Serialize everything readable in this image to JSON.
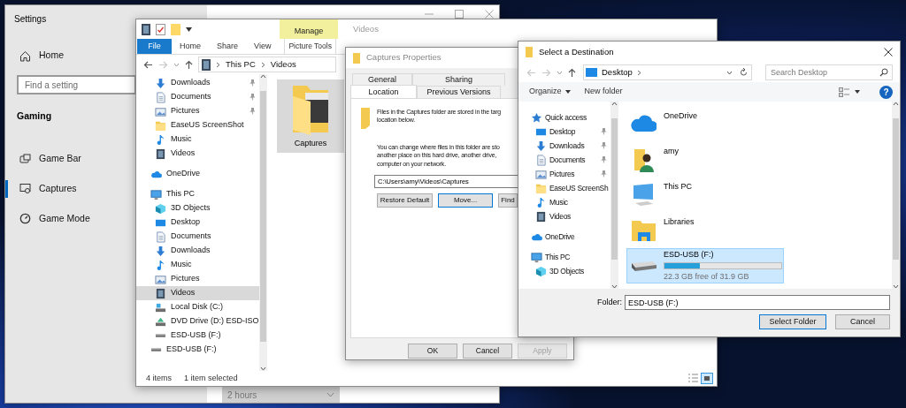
{
  "settings": {
    "title": "Settings",
    "home": {
      "label": "Home"
    },
    "search": {
      "placeholder": "Find a setting"
    },
    "section": "Gaming",
    "items": [
      {
        "kind": "game_bar",
        "label": "Game Bar",
        "selected": false
      },
      {
        "kind": "captures",
        "label": "Captures",
        "selected": true
      },
      {
        "kind": "game_mode",
        "label": "Game Mode",
        "selected": false
      }
    ],
    "duration": {
      "value": "2 hours"
    }
  },
  "explorer": {
    "title": "Videos",
    "ribbon_tabs": [
      {
        "kind": "file",
        "label": "File"
      },
      {
        "kind": "tab",
        "label": "Home"
      },
      {
        "kind": "tab",
        "label": "Share"
      },
      {
        "kind": "tab",
        "label": "View"
      }
    ],
    "context_tab": {
      "group": "Manage",
      "label": "Picture Tools"
    },
    "breadcrumb": [
      "This PC",
      "Videos"
    ],
    "quick_access": [
      {
        "kind": "download",
        "label": "Downloads",
        "pinned": true,
        "selected": false
      },
      {
        "kind": "document",
        "label": "Documents",
        "pinned": true,
        "selected": false
      },
      {
        "kind": "picture",
        "label": "Pictures",
        "pinned": true,
        "selected": false
      },
      {
        "kind": "folder",
        "label": "EaseUS ScreenShot",
        "pinned": false,
        "selected": false
      },
      {
        "kind": "music",
        "label": "Music",
        "pinned": false,
        "selected": false
      },
      {
        "kind": "video",
        "label": "Videos",
        "pinned": false,
        "selected": false
      }
    ],
    "tree": [
      {
        "kind": "cloud",
        "label": "OneDrive",
        "selected": false
      },
      {
        "kind": "pc",
        "label": "This PC",
        "selected": false,
        "children": [
          {
            "kind": "cube",
            "label": "3D Objects",
            "selected": false
          },
          {
            "kind": "desktop",
            "label": "Desktop",
            "selected": false
          },
          {
            "kind": "document",
            "label": "Documents",
            "selected": false
          },
          {
            "kind": "download",
            "label": "Downloads",
            "selected": false
          },
          {
            "kind": "music",
            "label": "Music",
            "selected": false
          },
          {
            "kind": "picture",
            "label": "Pictures",
            "selected": false
          },
          {
            "kind": "video",
            "label": "Videos",
            "selected": true
          },
          {
            "kind": "disk",
            "label": "Local Disk (C:)",
            "selected": false
          },
          {
            "kind": "dvd",
            "label": "DVD Drive (D:) ESD-ISO",
            "selected": false
          },
          {
            "kind": "usb",
            "label": "ESD-USB (F:)",
            "selected": false
          }
        ]
      },
      {
        "kind": "usb",
        "label": "ESD-USB (F:)",
        "selected": false
      }
    ],
    "files": [
      {
        "label": "Captures",
        "selected": true
      }
    ],
    "status": [
      "4 items",
      "1 item selected"
    ]
  },
  "properties": {
    "title": "Captures Properties",
    "tab_rows": [
      [
        {
          "label": "General",
          "selected": false
        },
        {
          "label": "Sharing",
          "selected": false
        }
      ],
      [
        {
          "label": "Location",
          "selected": true
        },
        {
          "label": "Previous Versions",
          "selected": false
        }
      ]
    ],
    "intro_lines": [
      "Files in the Captures folder are stored in the targ",
      "location below."
    ],
    "change_lines": [
      "You can change where files in this folder are sto",
      "another place on this hard drive, another drive,",
      "computer on your network."
    ],
    "path": "C:\\Users\\amy\\Videos\\Captures",
    "actions": [
      {
        "label": "Restore Default",
        "focused": false
      },
      {
        "label": "Move...",
        "focused": true
      },
      {
        "label": "Find",
        "focused": false
      }
    ],
    "buttons": [
      {
        "label": "OK",
        "disabled": false
      },
      {
        "label": "Cancel",
        "disabled": false
      },
      {
        "label": "Apply",
        "disabled": true
      }
    ]
  },
  "destination": {
    "title": "Select a Destination",
    "location": "Desktop",
    "search": {
      "placeholder": "Search Desktop"
    },
    "toolbar": [
      "Organize",
      "New folder"
    ],
    "help": "?",
    "tree": [
      {
        "kind": "star",
        "label": "Quick access",
        "children": [
          {
            "kind": "desktop",
            "label": "Desktop",
            "pinned": true
          },
          {
            "kind": "download",
            "label": "Downloads",
            "pinned": true
          },
          {
            "kind": "document",
            "label": "Documents",
            "pinned": true
          },
          {
            "kind": "picture",
            "label": "Pictures",
            "pinned": true
          },
          {
            "kind": "folder",
            "label": "EaseUS ScreenSh",
            "pinned": false
          },
          {
            "kind": "music",
            "label": "Music",
            "pinned": false
          },
          {
            "kind": "video",
            "label": "Videos",
            "pinned": false
          }
        ]
      },
      {
        "kind": "cloud",
        "label": "OneDrive"
      },
      {
        "kind": "pc",
        "label": "This PC",
        "children": [
          {
            "kind": "cube",
            "label": "3D Objects"
          }
        ]
      }
    ],
    "items": [
      {
        "kind": "cloud",
        "label": "OneDrive",
        "selected": false
      },
      {
        "kind": "user",
        "label": "amy",
        "selected": false
      },
      {
        "kind": "pc",
        "label": "This PC",
        "selected": false
      },
      {
        "kind": "library",
        "label": "Libraries",
        "selected": false
      },
      {
        "kind": "drive",
        "label": "ESD-USB (F:)",
        "level": 0.3,
        "detail": "22.3 GB free of 31.9 GB",
        "selected": true
      }
    ],
    "folder": {
      "label": "Folder:",
      "value": "ESD-USB (F:)"
    },
    "buttons": [
      {
        "kind": "default",
        "label": "Select Folder"
      },
      {
        "kind": "normal",
        "label": "Cancel"
      }
    ]
  }
}
